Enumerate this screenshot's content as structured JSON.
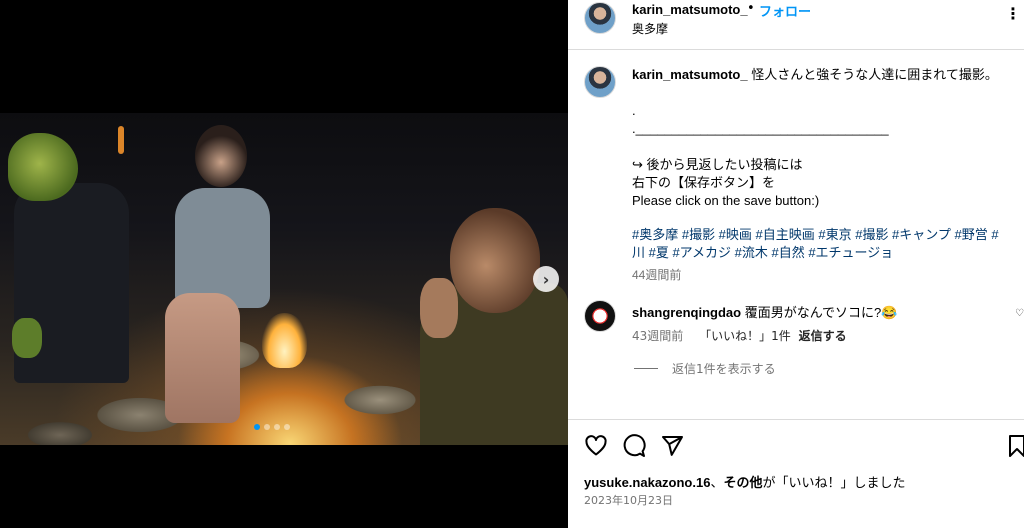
{
  "post": {
    "username": "karin_matsumoto_",
    "separator": "•",
    "follow_label": "フォロー",
    "location": "奥多摩",
    "more_label": "⋮"
  },
  "caption": {
    "username": "karin_matsumoto_",
    "text": "怪人さんと強そうな人達に囲まれて撮影。",
    "dot1": ".",
    "divider": ".___________________________________",
    "line1": "↪ 後から見返したい投稿には",
    "line2": "右下の【保存ボタン】を",
    "line3": "Please click on the save button:)",
    "hashtags_line1": "#奥多摩 #撮影 #映画 #自主映画 #東京 #撮影 #キャンプ #野営 #",
    "hashtags_line2": "川 #夏 #アメカジ #流木 #自然 #エチュージョ",
    "time_ago": "44週間前"
  },
  "comment": {
    "username": "shangrenqingdao",
    "text": "覆面男がなんでソコに?😂",
    "time_ago": "43週間前",
    "likes": "「いいね！」1件",
    "reply_label": "返信する",
    "heart": "♡"
  },
  "view_replies_label": "返信1件を表示する",
  "likes_line": {
    "user": "yusuke.nakazono.16",
    "middle": "、",
    "others": "その他",
    "suffix": "が「いいね！」しました"
  },
  "post_date": "2023年10月23日",
  "carousel": {
    "next_glyph": "›",
    "dot_count": 4,
    "active_dot": 0
  },
  "colors": {
    "accent": "#0095f6",
    "hashtag": "#00376b",
    "muted": "#737373"
  },
  "icons": [
    "heart-icon",
    "comment-icon",
    "share-icon",
    "bookmark-icon"
  ]
}
